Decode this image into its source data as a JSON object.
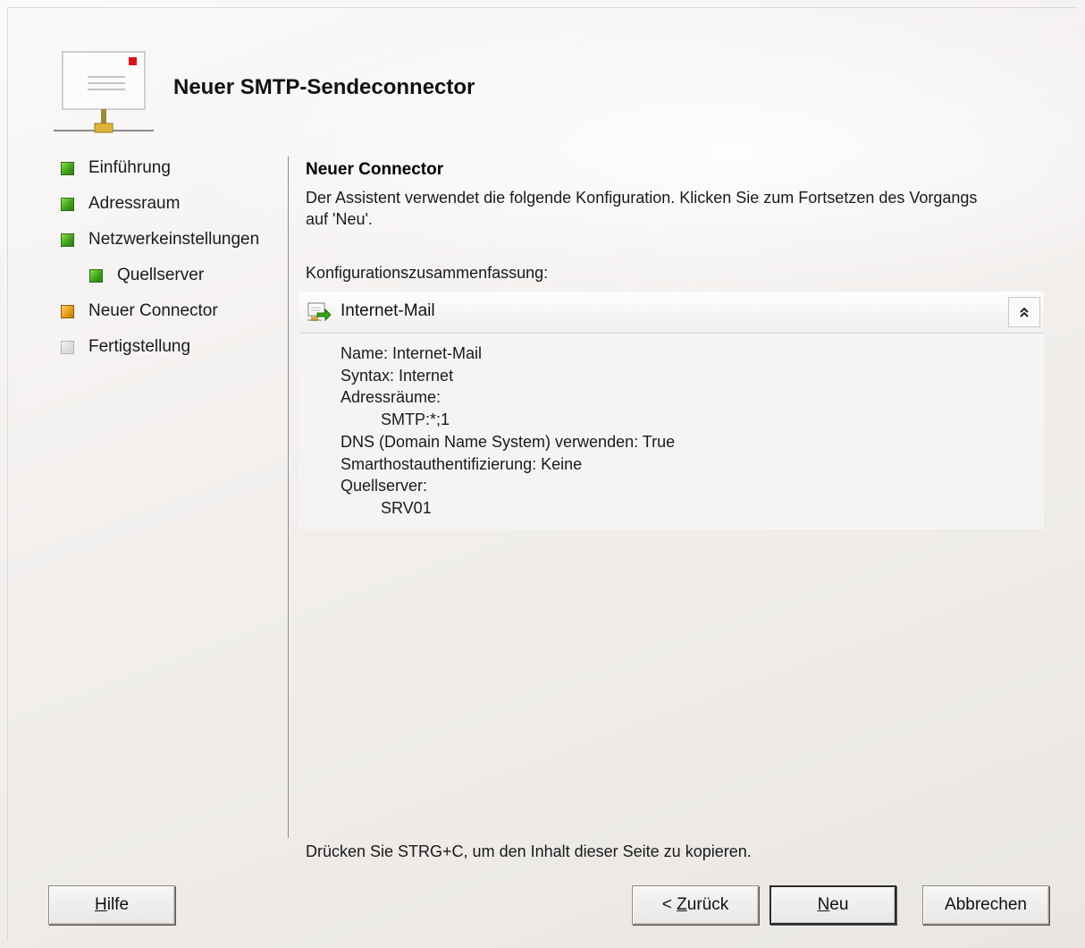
{
  "window": {
    "title": "Neuer SMTP-Sendeconnector"
  },
  "steps": [
    {
      "label": "Einführung",
      "status": "completed",
      "color": "#3a9e18"
    },
    {
      "label": "Adressraum",
      "status": "completed",
      "color": "#3a9e18"
    },
    {
      "label": "Netzwerkeinstellungen",
      "status": "completed",
      "color": "#3a9e18"
    },
    {
      "label": "Quellserver",
      "status": "completed",
      "color": "#3a9e18"
    },
    {
      "label": "Neuer Connector",
      "status": "current",
      "color": "#e49a14"
    },
    {
      "label": "Fertigstellung",
      "status": "pending",
      "color": "#d0d0d0"
    }
  ],
  "main": {
    "section_title": "Neuer Connector",
    "description": "Der Assistent verwendet die folgende Konfiguration. Klicken Sie zum Fortsetzen des Vorgangs auf 'Neu'.",
    "summary_label": "Konfigurationszusammenfassung:",
    "summary": {
      "title": "Internet-Mail",
      "collapse_icon": "chevron-double-up-icon",
      "lines": [
        "Name: Internet-Mail",
        "Syntax: Internet",
        "Adressräume:",
        "SMTP:*;1",
        "DNS (Domain Name System) verwenden: True",
        "Smarthostauthentifizierung: Keine",
        "Quellserver:",
        "SRV01"
      ]
    },
    "copy_hint": "Drücken Sie STRG+C, um den Inhalt dieser Seite zu kopieren."
  },
  "buttons": {
    "help": {
      "accel": "H",
      "rest": "ilfe"
    },
    "back": {
      "prefix": "< ",
      "accel": "Z",
      "rest": "urück"
    },
    "new": {
      "accel": "N",
      "rest": "eu"
    },
    "cancel": "Abbrechen"
  }
}
